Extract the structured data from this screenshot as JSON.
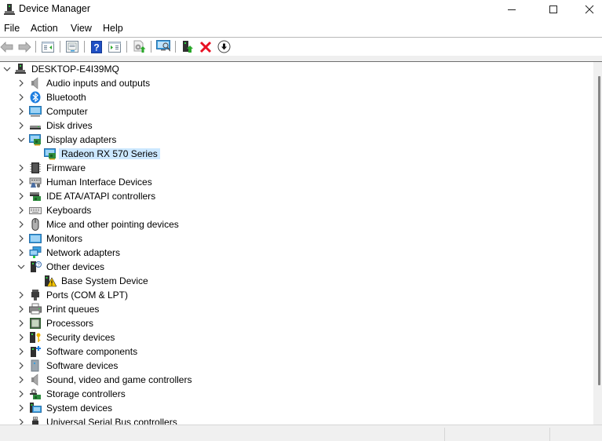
{
  "window": {
    "title": "Device Manager",
    "minimize_label": "Minimize",
    "maximize_label": "Maximize",
    "close_label": "Close"
  },
  "menu": {
    "items": [
      {
        "label": "File"
      },
      {
        "label": "Action"
      },
      {
        "label": "View"
      },
      {
        "label": "Help"
      }
    ]
  },
  "toolbar": {
    "buttons": [
      {
        "name": "back",
        "icon": "back-arrow-icon",
        "enabled": false
      },
      {
        "name": "forward",
        "icon": "forward-arrow-icon",
        "enabled": false
      },
      {
        "name": "show-hide-console-tree",
        "icon": "console-tree-icon"
      },
      {
        "name": "properties",
        "icon": "properties-icon"
      },
      {
        "name": "help",
        "icon": "help-icon"
      },
      {
        "name": "show-hide-action-pane",
        "icon": "action-pane-icon"
      },
      {
        "name": "update-driver",
        "icon": "update-driver-icon"
      },
      {
        "name": "scan-hardware-changes",
        "icon": "scan-hardware-icon"
      },
      {
        "name": "enable-device",
        "icon": "enable-device-icon"
      },
      {
        "name": "uninstall-device",
        "icon": "uninstall-icon"
      },
      {
        "name": "disable-device",
        "icon": "disable-device-icon"
      }
    ]
  },
  "tree": {
    "root": {
      "label": "DESKTOP-E4I39MQ",
      "expanded": true,
      "icon": "computer-root-icon"
    },
    "categories": [
      {
        "label": "Audio inputs and outputs",
        "icon": "speaker-icon",
        "expanded": false
      },
      {
        "label": "Bluetooth",
        "icon": "bluetooth-icon",
        "expanded": false
      },
      {
        "label": "Computer",
        "icon": "computer-icon",
        "expanded": false
      },
      {
        "label": "Disk drives",
        "icon": "disk-drive-icon",
        "expanded": false
      },
      {
        "label": "Display adapters",
        "icon": "display-adapter-icon",
        "expanded": true,
        "children": [
          {
            "label": "Radeon RX 570 Series",
            "icon": "display-adapter-icon",
            "selected": true
          }
        ]
      },
      {
        "label": "Firmware",
        "icon": "firmware-icon",
        "expanded": false
      },
      {
        "label": "Human Interface Devices",
        "icon": "hid-icon",
        "expanded": false
      },
      {
        "label": "IDE ATA/ATAPI controllers",
        "icon": "ide-controller-icon",
        "expanded": false
      },
      {
        "label": "Keyboards",
        "icon": "keyboard-icon",
        "expanded": false
      },
      {
        "label": "Mice and other pointing devices",
        "icon": "mouse-icon",
        "expanded": false
      },
      {
        "label": "Monitors",
        "icon": "monitor-icon",
        "expanded": false
      },
      {
        "label": "Network adapters",
        "icon": "network-adapter-icon",
        "expanded": false
      },
      {
        "label": "Other devices",
        "icon": "unknown-device-icon",
        "expanded": true,
        "children": [
          {
            "label": "Base System Device",
            "icon": "warning-device-icon",
            "selected": false
          }
        ]
      },
      {
        "label": "Ports (COM & LPT)",
        "icon": "port-icon",
        "expanded": false
      },
      {
        "label": "Print queues",
        "icon": "printer-icon",
        "expanded": false
      },
      {
        "label": "Processors",
        "icon": "processor-icon",
        "expanded": false
      },
      {
        "label": "Security devices",
        "icon": "security-device-icon",
        "expanded": false
      },
      {
        "label": "Software components",
        "icon": "software-component-icon",
        "expanded": false
      },
      {
        "label": "Software devices",
        "icon": "software-device-icon",
        "expanded": false
      },
      {
        "label": "Sound, video and game controllers",
        "icon": "speaker-icon",
        "expanded": false
      },
      {
        "label": "Storage controllers",
        "icon": "storage-controller-icon",
        "expanded": false
      },
      {
        "label": "System devices",
        "icon": "system-device-icon",
        "expanded": false
      },
      {
        "label": "Universal Serial Bus controllers",
        "icon": "usb-icon",
        "expanded": false
      }
    ]
  },
  "colors": {
    "selection": "#cce8ff",
    "status_bar": "#f0f0f0",
    "delete_red": "#e81123",
    "help_blue": "#1f4fc4"
  }
}
